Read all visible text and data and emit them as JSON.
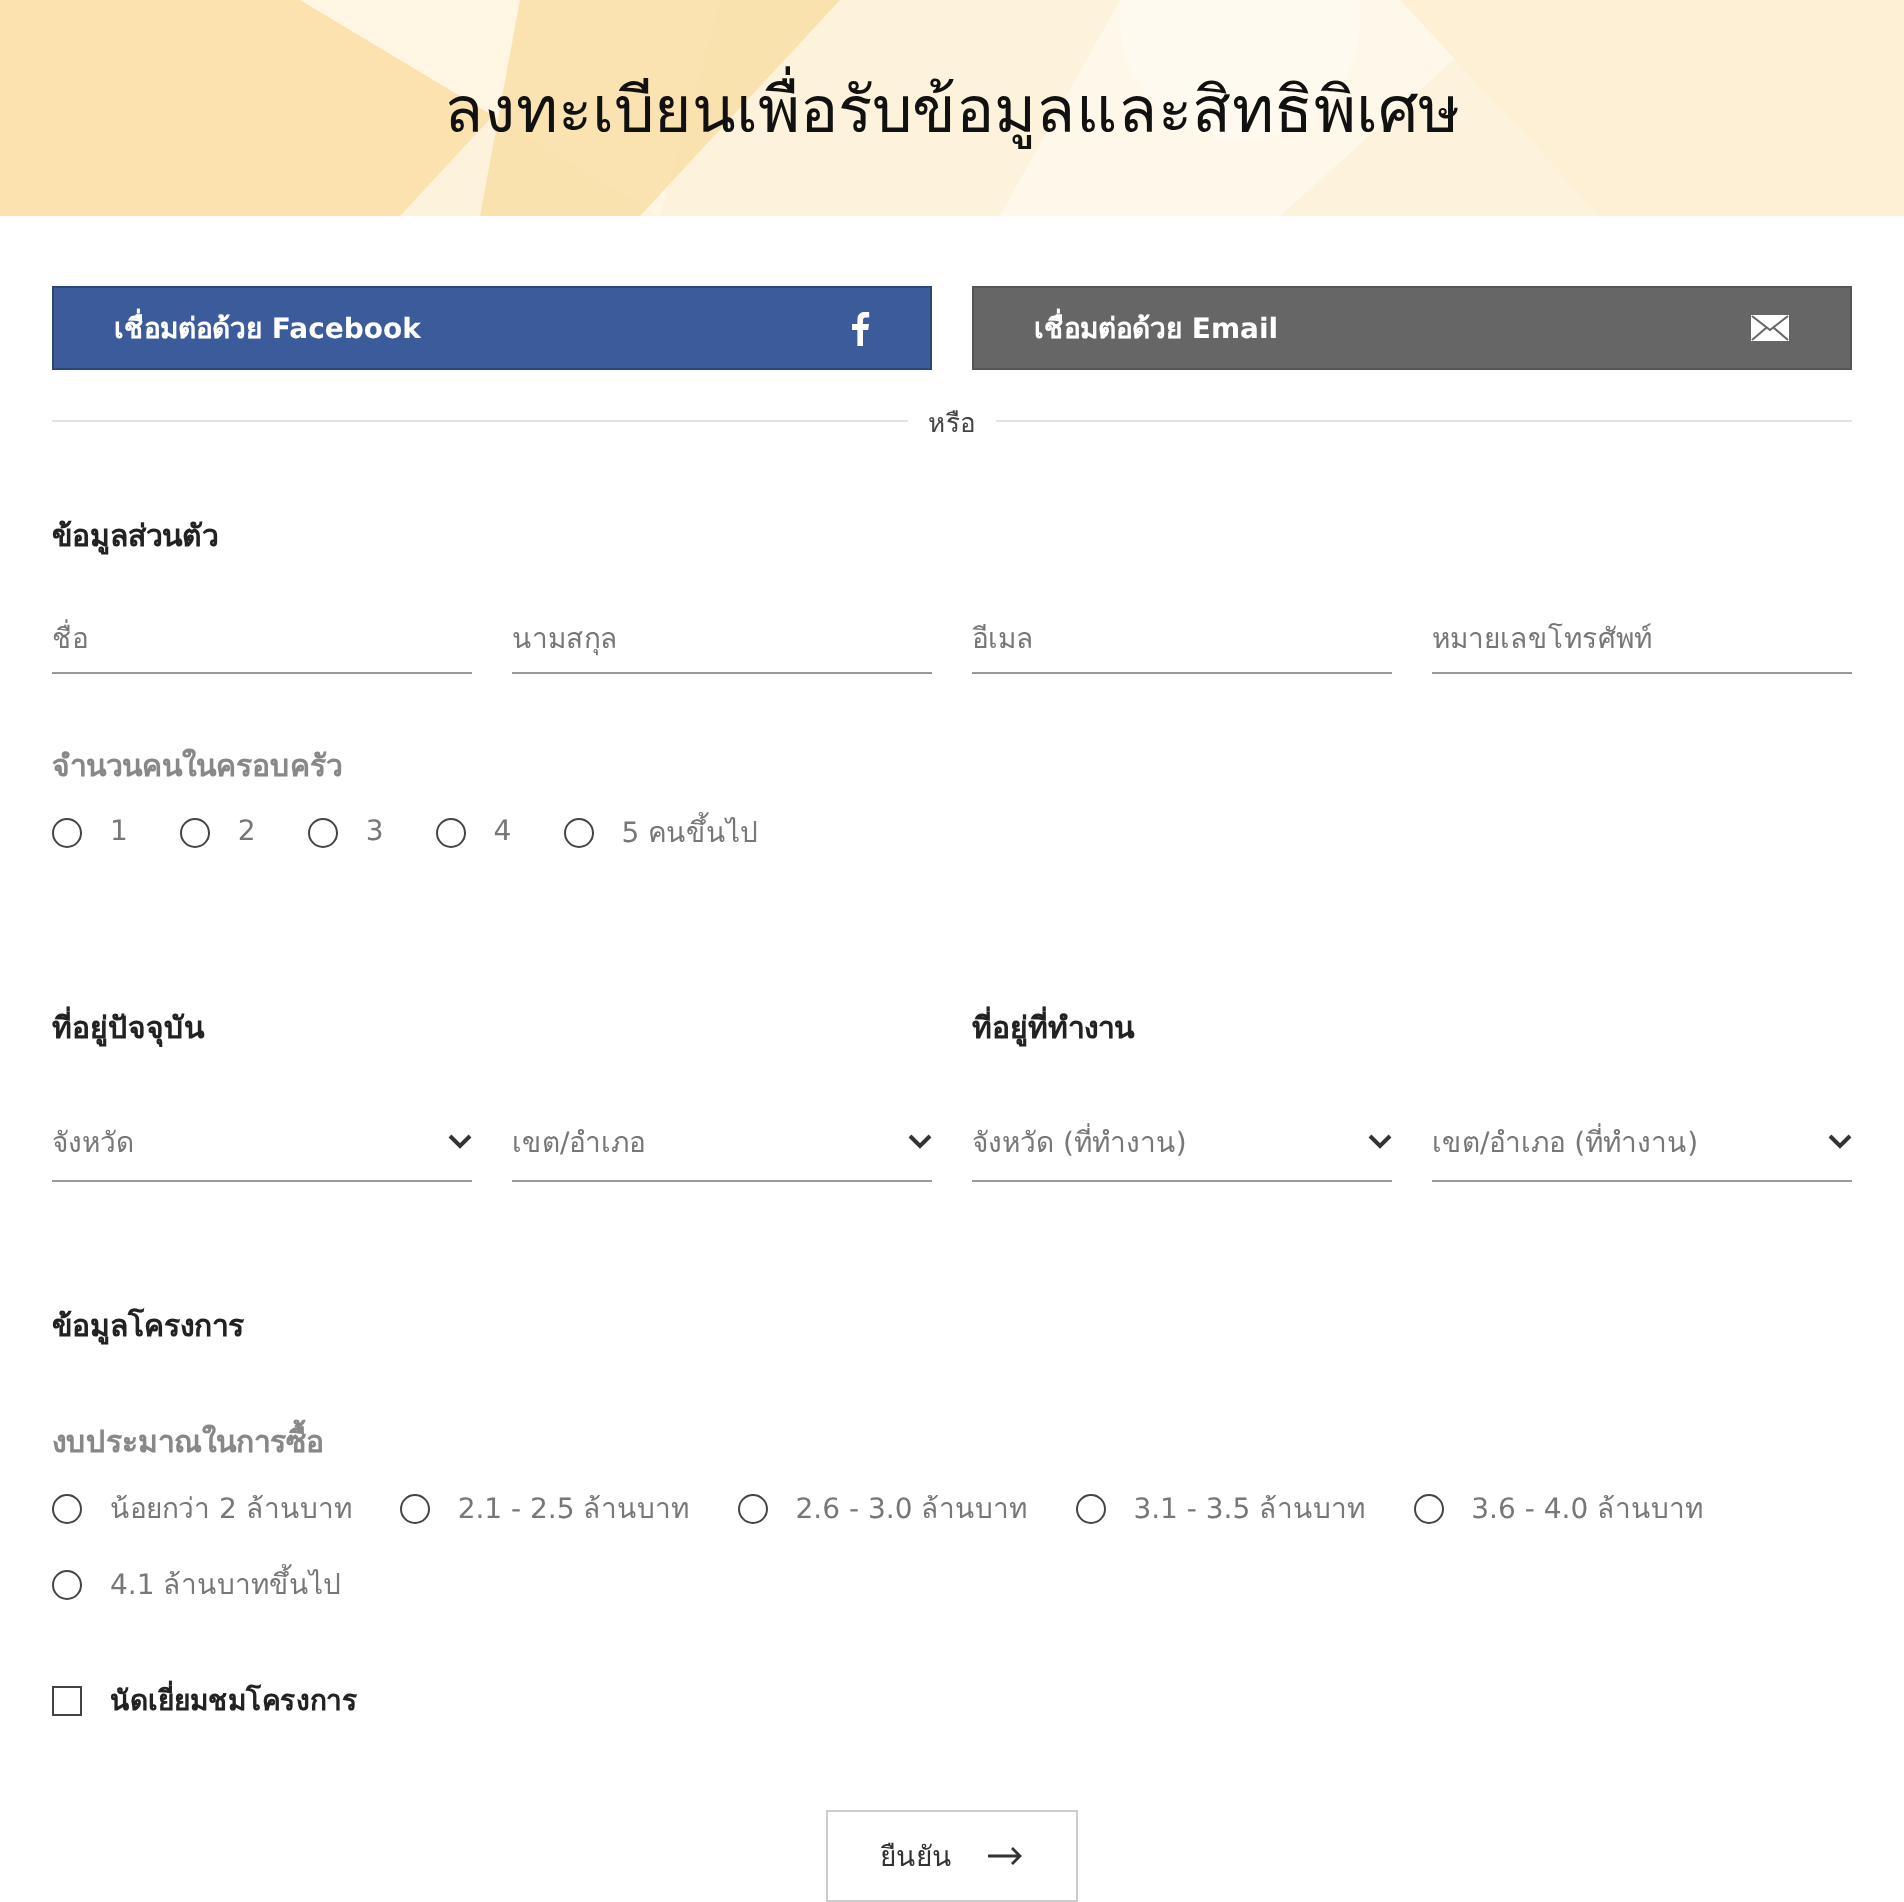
{
  "header": {
    "title": "ลงทะเบียนเพื่อรับข้อมูลและสิทธิพิเศษ"
  },
  "social_buttons": [
    {
      "kind": "facebook",
      "label": "เชื่อมต่อด้วย Facebook"
    },
    {
      "kind": "email",
      "label": "เชื่อมต่อด้วย Email"
    }
  ],
  "divider": {
    "label": "หรือ"
  },
  "personal": {
    "heading": "ข้อมูลส่วนตัว",
    "fields": [
      {
        "placeholder": "ชื่อ"
      },
      {
        "placeholder": "นามสกุล"
      },
      {
        "placeholder": "อีเมล"
      },
      {
        "placeholder": "หมายเลขโทรศัพท์"
      }
    ],
    "household": {
      "label": "จำนวนคนในครอบครัว",
      "options": [
        {
          "label": "1",
          "selected": false
        },
        {
          "label": "2",
          "selected": false
        },
        {
          "label": "3",
          "selected": false
        },
        {
          "label": "4",
          "selected": false
        },
        {
          "label": "5 คนขึ้นไป",
          "selected": false
        }
      ]
    }
  },
  "addresses": [
    {
      "heading": "ที่อยู่ปัจจุบัน",
      "selects": [
        {
          "placeholder": "จังหวัด"
        },
        {
          "placeholder": "เขต/อำเภอ"
        }
      ]
    },
    {
      "heading": "ที่อยู่ที่ทำงาน",
      "selects": [
        {
          "placeholder": "จังหวัด (ที่ทำงาน)"
        },
        {
          "placeholder": "เขต/อำเภอ (ที่ทำงาน)"
        }
      ]
    }
  ],
  "project": {
    "heading": "ข้อมูลโครงการ",
    "budget": {
      "label": "งบประมาณในการซื้อ",
      "options": [
        {
          "label": "น้อยกว่า 2 ล้านบาท",
          "selected": false
        },
        {
          "label": "2.1 - 2.5 ล้านบาท",
          "selected": false
        },
        {
          "label": "2.6 - 3.0 ล้านบาท",
          "selected": false
        },
        {
          "label": "3.1 - 3.5 ล้านบาท",
          "selected": false
        },
        {
          "label": "3.6 - 4.0 ล้านบาท",
          "selected": false
        },
        {
          "label": "4.1 ล้านบาทขึ้นไป",
          "selected": false
        }
      ]
    },
    "visit": {
      "label": "นัดเยี่ยมชมโครงการ",
      "checked": false
    }
  },
  "submit": {
    "label": "ยืนยัน"
  }
}
